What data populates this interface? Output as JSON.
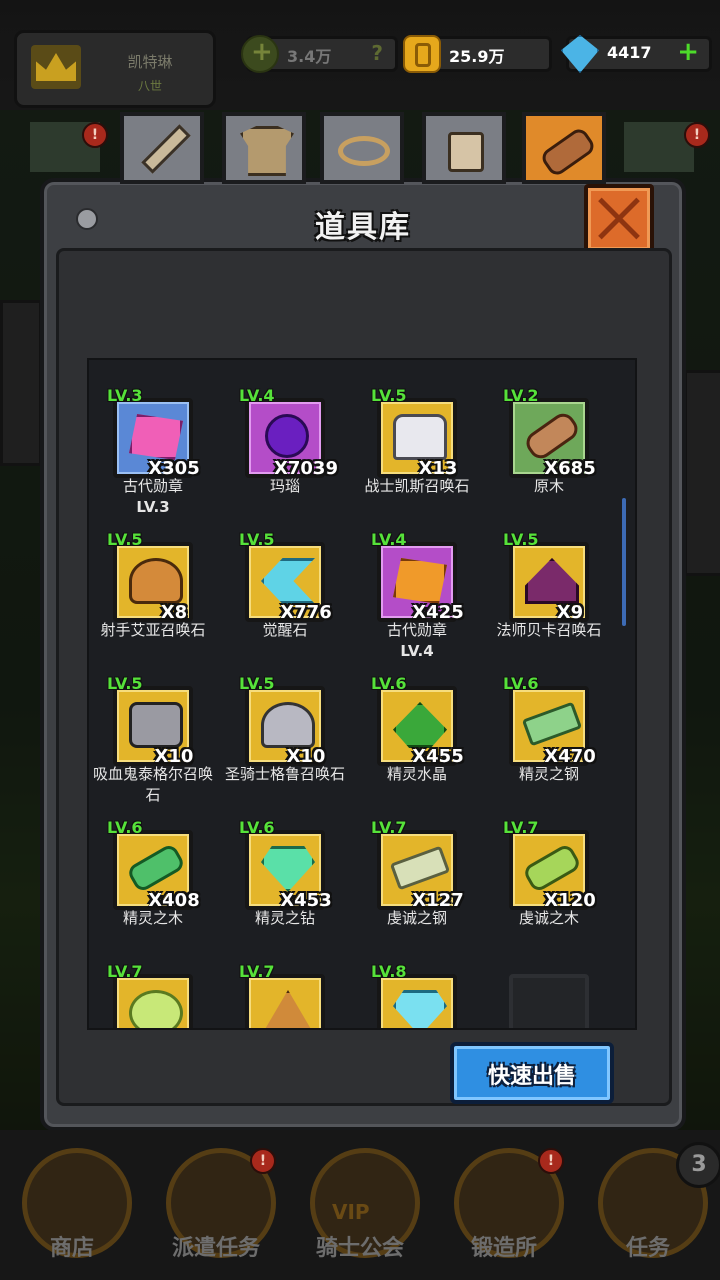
{
  "player": {
    "name": "凯特琳",
    "level": "八世"
  },
  "resources": {
    "power": "3.4万",
    "power_help": "?",
    "gold": "25.9万",
    "gems": "4417",
    "add": "+"
  },
  "side_alert": "!",
  "panel": {
    "title": "道具库",
    "sell_label": "快速出售"
  },
  "tabs": [
    "sword",
    "armor",
    "ring",
    "potion",
    "material"
  ],
  "active_tab": "material",
  "items": [
    {
      "lv": "LV.3",
      "qty": "X305",
      "name": "古代勋章",
      "sub": "LV.3",
      "frame": "blue",
      "art": "medal-pink"
    },
    {
      "lv": "LV.4",
      "qty": "X7039",
      "name": "玛瑙",
      "sub": "",
      "frame": "purple",
      "art": "agate"
    },
    {
      "lv": "LV.5",
      "qty": "X13",
      "name": "战士凯斯召唤石",
      "sub": "",
      "frame": "gold",
      "art": "knight"
    },
    {
      "lv": "LV.2",
      "qty": "X685",
      "name": "原木",
      "sub": "",
      "frame": "green",
      "art": "log"
    },
    {
      "lv": "LV.5",
      "qty": "X8",
      "name": "射手艾亚召唤石",
      "sub": "",
      "frame": "gold",
      "art": "archer"
    },
    {
      "lv": "LV.5",
      "qty": "X776",
      "name": "觉醒石",
      "sub": "",
      "frame": "gold",
      "art": "crystal-blue"
    },
    {
      "lv": "LV.4",
      "qty": "X425",
      "name": "古代勋章",
      "sub": "LV.4",
      "frame": "purple",
      "art": "medal-orange"
    },
    {
      "lv": "LV.5",
      "qty": "X9",
      "name": "法师贝卡召唤石",
      "sub": "",
      "frame": "gold",
      "art": "mage"
    },
    {
      "lv": "LV.5",
      "qty": "X10",
      "name": "吸血鬼泰格尔召唤石",
      "sub": "",
      "frame": "gold",
      "art": "vampire"
    },
    {
      "lv": "LV.5",
      "qty": "X10",
      "name": "圣骑士格鲁召唤石",
      "sub": "",
      "frame": "gold",
      "art": "paladin"
    },
    {
      "lv": "LV.6",
      "qty": "X455",
      "name": "精灵水晶",
      "sub": "",
      "frame": "gold",
      "art": "green-crystal"
    },
    {
      "lv": "LV.6",
      "qty": "X470",
      "name": "精灵之钢",
      "sub": "",
      "frame": "gold",
      "art": "steel-green"
    },
    {
      "lv": "LV.6",
      "qty": "X408",
      "name": "精灵之木",
      "sub": "",
      "frame": "gold",
      "art": "wood-green"
    },
    {
      "lv": "LV.6",
      "qty": "X453",
      "name": "精灵之钻",
      "sub": "",
      "frame": "gold",
      "art": "diamond-green"
    },
    {
      "lv": "LV.7",
      "qty": "X127",
      "name": "虔诚之钢",
      "sub": "",
      "frame": "gold",
      "art": "steel-pale"
    },
    {
      "lv": "LV.7",
      "qty": "X120",
      "name": "虔诚之木",
      "sub": "",
      "frame": "gold",
      "art": "wood-lime"
    },
    {
      "lv": "LV.7",
      "qty": "",
      "name": "",
      "sub": "",
      "frame": "gold",
      "art": "orb-lime"
    },
    {
      "lv": "LV.7",
      "qty": "",
      "name": "",
      "sub": "",
      "frame": "gold",
      "art": "pyramid"
    },
    {
      "lv": "LV.8",
      "qty": "",
      "name": "",
      "sub": "",
      "frame": "gold",
      "art": "diamond-cyan"
    },
    {
      "lv": "",
      "qty": "",
      "name": "",
      "sub": "",
      "frame": "empty",
      "art": ""
    }
  ],
  "nav": [
    {
      "label": "商店",
      "alert": ""
    },
    {
      "label": "派遣任务",
      "alert": "!"
    },
    {
      "label": "骑士公会",
      "alert": "",
      "badge": "VIP"
    },
    {
      "label": "锻造所",
      "alert": "!"
    },
    {
      "label": "任务",
      "alert": "3"
    }
  ],
  "colors": {
    "level_text": "#56e23a",
    "active_tab": "#e08a2a",
    "sell_button": "#2f8fe2",
    "close_button": "#dd6b2a"
  }
}
